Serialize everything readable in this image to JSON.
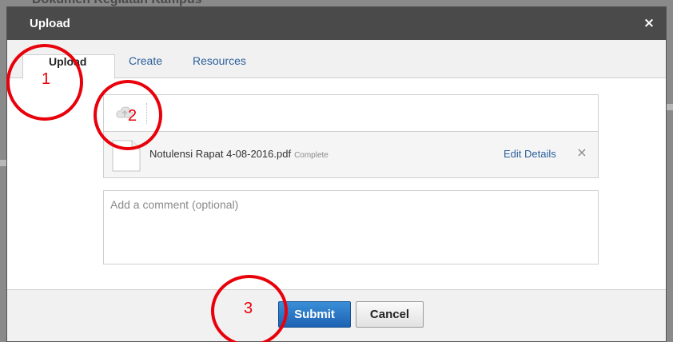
{
  "background_page": {
    "heading_fragment": "Dokumen Kegiatan Kampus"
  },
  "modal": {
    "title": "Upload",
    "close_label": "×",
    "tabs": [
      {
        "label": "Upload",
        "active": true
      },
      {
        "label": "Create",
        "active": false
      },
      {
        "label": "Resources",
        "active": false
      }
    ],
    "file": {
      "name": "Notulensi Rapat 4-08-2016.pdf",
      "status": "Complete",
      "edit_label": "Edit Details",
      "remove_label": "×"
    },
    "comment": {
      "value": "",
      "placeholder": "Add a comment (optional)"
    },
    "footer": {
      "submit_label": "Submit",
      "cancel_label": "Cancel"
    }
  },
  "annotations": [
    {
      "label": "1"
    },
    {
      "label": "2"
    },
    {
      "label": "3"
    }
  ],
  "colors": {
    "titlebar": "#4a4a4a",
    "link": "#2b5f9b",
    "submit": "#1d62b3",
    "annotation": "#e8000b"
  },
  "icons": {
    "upload_area": "cloud-upload-icon",
    "file": "document-icon",
    "remove": "close-icon"
  }
}
